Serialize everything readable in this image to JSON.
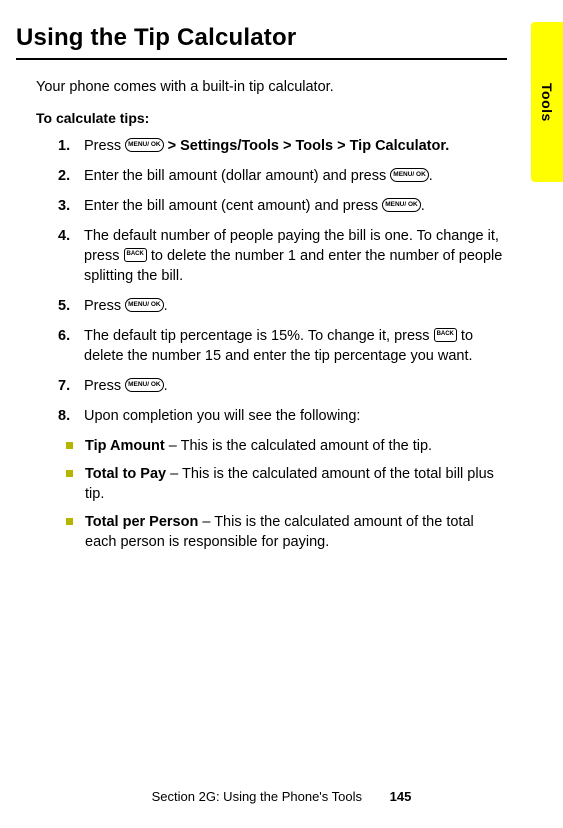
{
  "tab_label": "Tools",
  "title": "Using the Tip Calculator",
  "intro": "Your phone comes with a built-in tip calculator.",
  "subheading": "To calculate tips:",
  "keys": {
    "ok": "MENU/\nOK",
    "back": "BACK"
  },
  "steps": [
    {
      "num": "1.",
      "pre": "Press ",
      "key": "ok",
      "post_bold": " > Settings/Tools > Tools > Tip Calculator."
    },
    {
      "num": "2.",
      "pre": "Enter the bill amount (dollar amount) and press ",
      "key": "ok",
      "post": "."
    },
    {
      "num": "3.",
      "pre": "Enter the bill amount (cent amount) and press ",
      "key": "ok",
      "post": "."
    },
    {
      "num": "4.",
      "pre": "The default number of people paying the bill is one. To change it, press ",
      "key": "back",
      "post": " to delete the number 1 and enter the number of people splitting the bill."
    },
    {
      "num": "5.",
      "pre": "Press ",
      "key": "ok",
      "post": "."
    },
    {
      "num": "6.",
      "pre": "The default tip percentage is 15%. To change it, press ",
      "key": "back",
      "post": " to delete the number 15 and enter the tip percentage you want."
    },
    {
      "num": "7.",
      "pre": "Press ",
      "key": "ok",
      "post": "."
    },
    {
      "num": "8.",
      "pre": "Upon completion you will see the following:"
    }
  ],
  "results": [
    {
      "label": "Tip Amount",
      "desc": " – This is the calculated amount of the tip."
    },
    {
      "label": "Total to Pay",
      "desc": " – This is the calculated amount of the total bill plus tip."
    },
    {
      "label": "Total per Person",
      "desc": " – This is the calculated amount of the total each person is responsible for paying."
    }
  ],
  "footer_section": "Section 2G: Using the Phone's Tools",
  "footer_page": "145"
}
